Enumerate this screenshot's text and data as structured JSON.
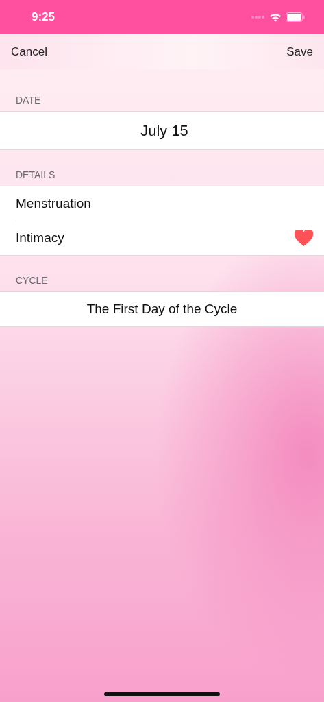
{
  "status_bar": {
    "time": "9:25"
  },
  "nav": {
    "left": "Cancel",
    "right": "Save"
  },
  "sections": [
    {
      "header": "DATE",
      "kind": "center-large",
      "rows": [
        {
          "label": "July 15"
        }
      ]
    },
    {
      "header": "DETAILS",
      "kind": "list",
      "rows": [
        {
          "label": "Menstruation",
          "marked": false
        },
        {
          "label": "Intimacy",
          "marked": true
        }
      ]
    },
    {
      "header": "CYCLE",
      "kind": "center",
      "rows": [
        {
          "label": "The First Day of the Cycle"
        }
      ]
    }
  ]
}
